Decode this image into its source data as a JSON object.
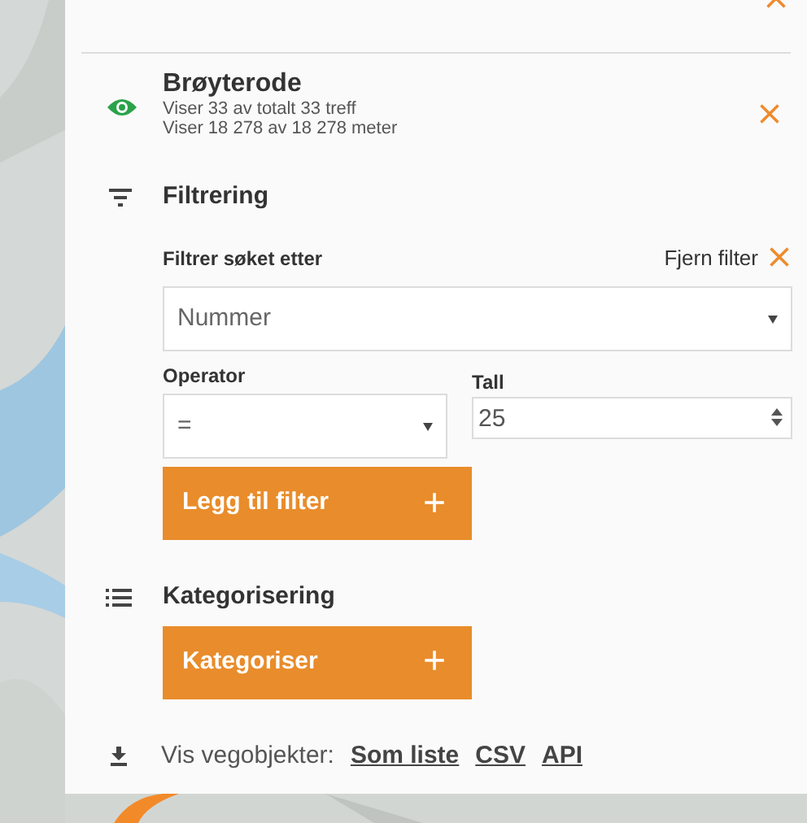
{
  "layer": {
    "title": "Brøyterode",
    "visible": true,
    "lines": [
      "Viser 33 av totalt 33 treff",
      "Viser 18 278 av 18 278 meter"
    ]
  },
  "filtering": {
    "heading": "Filtrering",
    "field_label": "Filtrer søket etter",
    "remove_label": "Fjern filter",
    "property_select": {
      "value": "Nummer"
    },
    "operator": {
      "label": "Operator",
      "value": "="
    },
    "number": {
      "label": "Tall",
      "value": "25"
    },
    "add_button": {
      "label": "Legg til filter",
      "icon": "+"
    }
  },
  "categorizing": {
    "heading": "Kategorisering",
    "button": {
      "label": "Kategoriser",
      "icon": "+"
    }
  },
  "export": {
    "label": "Vis vegobjekter:",
    "links": [
      "Som liste",
      "CSV",
      "API"
    ]
  }
}
